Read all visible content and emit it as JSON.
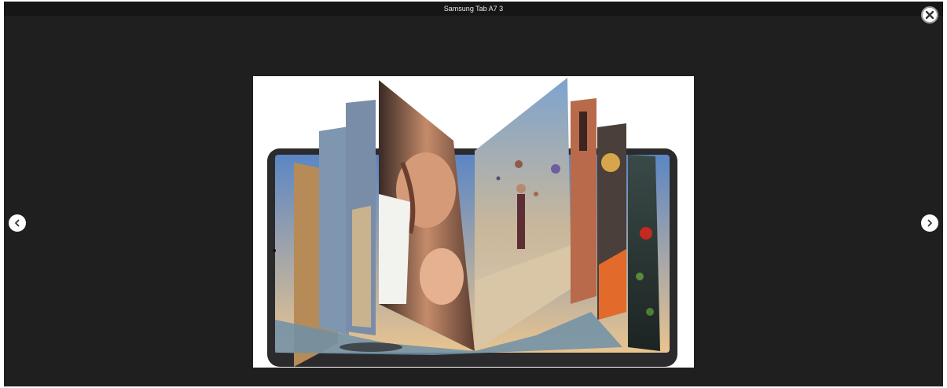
{
  "viewer": {
    "title": "Samsung Tab A7 3",
    "close_icon": "close-icon",
    "prev_icon": "chevron-left-icon",
    "next_icon": "chevron-right-icon"
  },
  "colors": {
    "backdrop": "#1f1f1f",
    "titlebar": "#161616",
    "button": "#ffffff"
  }
}
